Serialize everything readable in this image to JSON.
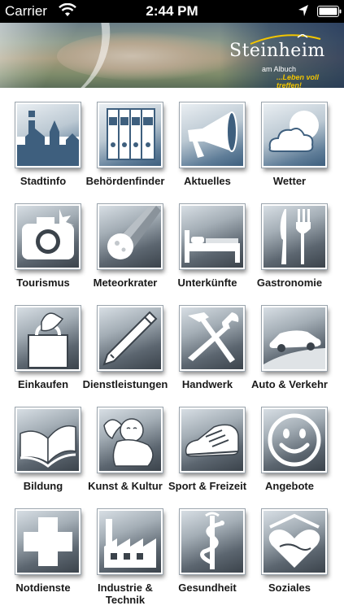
{
  "status_bar": {
    "carrier": "Carrier",
    "time": "2:44 PM"
  },
  "header": {
    "logo_name": "Steinheim",
    "logo_sub": "am Albuch",
    "logo_slogan": "...Leben voll treffen!"
  },
  "colors": {
    "icon_blue": "#3e5f7e",
    "icon_gray": "#3b434b"
  },
  "tiles": [
    {
      "label": "Stadtinfo",
      "icon": "stadtinfo-icon"
    },
    {
      "label": "Behördenfinder",
      "icon": "folders-icon"
    },
    {
      "label": "Aktuelles",
      "icon": "megaphone-icon"
    },
    {
      "label": "Wetter",
      "icon": "weather-icon"
    },
    {
      "label": "Tourismus",
      "icon": "camera-icon"
    },
    {
      "label": "Meteorkrater",
      "icon": "meteor-icon"
    },
    {
      "label": "Unterkünfte",
      "icon": "bed-icon"
    },
    {
      "label": "Gastronomie",
      "icon": "cutlery-icon"
    },
    {
      "label": "Einkaufen",
      "icon": "shopping-bag-icon"
    },
    {
      "label": "Dienstleistungen",
      "icon": "pencil-icon"
    },
    {
      "label": "Handwerk",
      "icon": "tools-icon"
    },
    {
      "label": "Auto & Verkehr",
      "icon": "car-icon"
    },
    {
      "label": "Bildung",
      "icon": "book-icon"
    },
    {
      "label": "Kunst & Kultur",
      "icon": "angel-icon"
    },
    {
      "label": "Sport & Freizeit",
      "icon": "sneaker-icon"
    },
    {
      "label": "Angebote",
      "icon": "smiley-icon"
    },
    {
      "label": "Notdienste",
      "icon": "cross-icon"
    },
    {
      "label": "Industrie & Technik",
      "icon": "factory-icon"
    },
    {
      "label": "Gesundheit",
      "icon": "caduceus-icon"
    },
    {
      "label": "Soziales",
      "icon": "heart-hands-icon"
    }
  ]
}
